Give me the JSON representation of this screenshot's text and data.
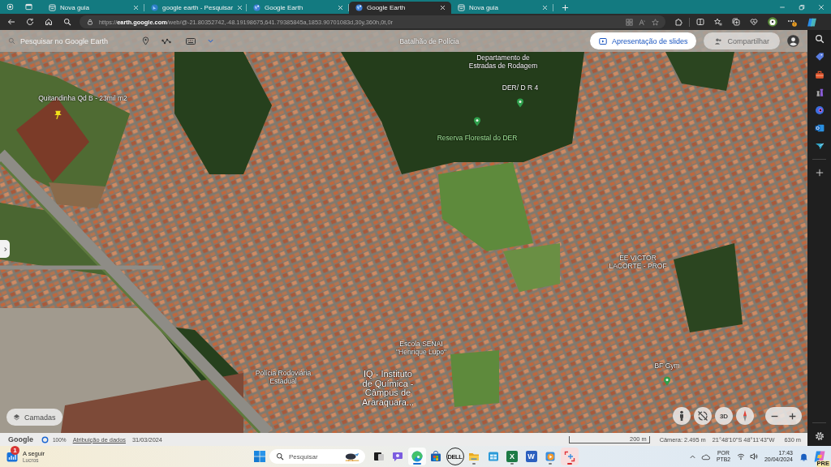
{
  "browser": {
    "tabs": [
      {
        "kind": "newtab",
        "title": "Nova guia",
        "selected": false
      },
      {
        "kind": "search",
        "title": "google earth - Pesquisar",
        "selected": false
      },
      {
        "kind": "earth",
        "title": "Google Earth",
        "selected": false
      },
      {
        "kind": "earth",
        "title": "Google Earth",
        "selected": true
      },
      {
        "kind": "newtab",
        "title": "Nova guia",
        "selected": false
      }
    ],
    "address": "https://**earth.google.com**/web/@-21.80352742,-48.19198675,641.79385845a,1853.90701083d,30y,360h,0t,0r"
  },
  "earth": {
    "search": {
      "placeholder": "Pesquisar no Google Earth"
    },
    "buttons": [
      {
        "kind": "slideshow",
        "label": "Apresentação de slides",
        "disabled": false
      },
      {
        "kind": "share",
        "label": "Compartilhar",
        "disabled": true
      }
    ],
    "map_labels": [
      {
        "kind": "faded",
        "lines": [
          "Batalhão de Polícia"
        ]
      },
      {
        "kind": "place",
        "lines": [
          "Departamento de",
          "Estradas de Rodagem"
        ]
      },
      {
        "kind": "place",
        "lines": [
          "DER/ D R 4"
        ]
      },
      {
        "kind": "park",
        "lines": [
          "Reserva Florestal do DER"
        ]
      },
      {
        "kind": "place",
        "lines": [
          "Quitandinha Qd B - 23mil m2"
        ]
      },
      {
        "kind": "place",
        "lines": [
          "EE VICTOR",
          "LACORTE - PROF"
        ]
      },
      {
        "kind": "place",
        "lines": [
          "Escola SENAI",
          "\"Henrique Lupo\""
        ]
      },
      {
        "kind": "place",
        "lines": [
          "Polícia Rodoviária",
          "Estadual"
        ]
      },
      {
        "kind": "large",
        "lines": [
          "IQ - Instituto",
          "de Química -",
          "Câmpus de",
          "Araraquara..."
        ]
      },
      {
        "kind": "place",
        "lines": [
          "BF Gym"
        ]
      }
    ],
    "layers_button": "Camadas",
    "view_button": "3D",
    "status_bar": {
      "logo": "Google",
      "load": "100%",
      "attribution": "Atribuição de dados",
      "date": "31/03/2024",
      "scale": "200 m",
      "camera": "Câmera: 2.495 m",
      "coordinates": "21°48'10\"S 48°11'43\"W",
      "altitude": "630 m"
    }
  },
  "taskbar": {
    "widget": {
      "badge": "1",
      "title": "A seguir",
      "subtitle": "Lucros"
    },
    "search": {
      "placeholder": "Pesquisar"
    },
    "apps": [
      {
        "kind": "taskview",
        "running": false,
        "selected": false,
        "attention": false
      },
      {
        "kind": "chat",
        "running": false,
        "selected": false,
        "attention": false
      },
      {
        "kind": "edge",
        "running": true,
        "selected": true,
        "attention": false
      },
      {
        "kind": "store",
        "running": false,
        "selected": false,
        "attention": false
      },
      {
        "kind": "dell",
        "text": "DELL",
        "running": false,
        "selected": false,
        "attention": false
      },
      {
        "kind": "explorer",
        "running": true,
        "selected": false,
        "attention": false
      },
      {
        "kind": "calendar",
        "running": false,
        "selected": false,
        "attention": false
      },
      {
        "kind": "excel",
        "text": "X",
        "running": true,
        "selected": false,
        "attention": false
      },
      {
        "kind": "word",
        "text": "W",
        "running": false,
        "selected": false,
        "attention": false
      },
      {
        "kind": "media",
        "running": true,
        "selected": false,
        "attention": false
      },
      {
        "kind": "snip",
        "running": true,
        "selected": false,
        "attention": true
      }
    ],
    "language": [
      "POR",
      "PTB2"
    ],
    "time": "17:43",
    "date": "20/04/2024",
    "assistant_badge": "PRE"
  }
}
